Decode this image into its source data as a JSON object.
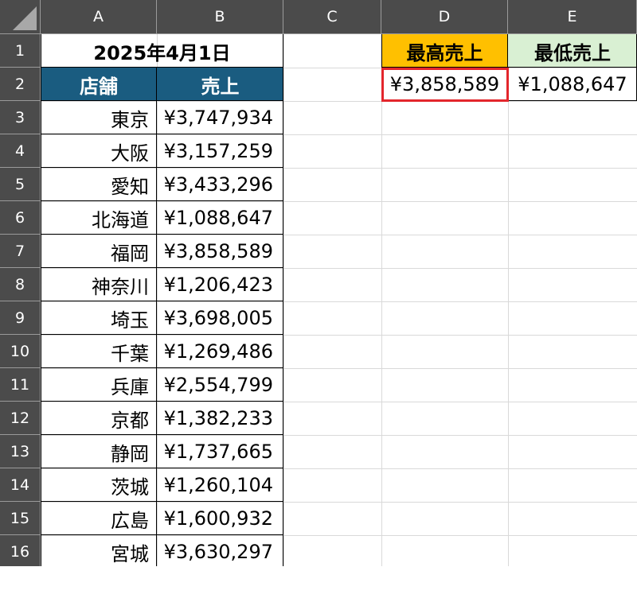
{
  "columns": [
    "A",
    "B",
    "C",
    "D",
    "E"
  ],
  "row_numbers": [
    "1",
    "2",
    "3",
    "4",
    "5",
    "6",
    "7",
    "8",
    "9",
    "10",
    "11",
    "12",
    "13",
    "14",
    "15",
    "16"
  ],
  "title": "2025年4月1日",
  "table_headers": {
    "store": "店舗",
    "sales": "売上"
  },
  "summary_headers": {
    "max": "最高売上",
    "min": "最低売上"
  },
  "summary_values": {
    "max": "¥3,858,589",
    "min": "¥1,088,647"
  },
  "rows": [
    {
      "store": "東京",
      "sales": "¥3,747,934"
    },
    {
      "store": "大阪",
      "sales": "¥3,157,259"
    },
    {
      "store": "愛知",
      "sales": "¥3,433,296"
    },
    {
      "store": "北海道",
      "sales": "¥1,088,647"
    },
    {
      "store": "福岡",
      "sales": "¥3,858,589"
    },
    {
      "store": "神奈川",
      "sales": "¥1,206,423"
    },
    {
      "store": "埼玉",
      "sales": "¥3,698,005"
    },
    {
      "store": "千葉",
      "sales": "¥1,269,486"
    },
    {
      "store": "兵庫",
      "sales": "¥2,554,799"
    },
    {
      "store": "京都",
      "sales": "¥1,382,233"
    },
    {
      "store": "静岡",
      "sales": "¥1,737,665"
    },
    {
      "store": "茨城",
      "sales": "¥1,260,104"
    },
    {
      "store": "広島",
      "sales": "¥1,600,932"
    },
    {
      "store": "宮城",
      "sales": "¥3,630,297"
    }
  ],
  "colors": {
    "header_bg": "#4b4b4b",
    "table_header": "#1a5c80",
    "max_header": "#ffc000",
    "min_header": "#d9f0d3",
    "selection": "#e3262c"
  }
}
